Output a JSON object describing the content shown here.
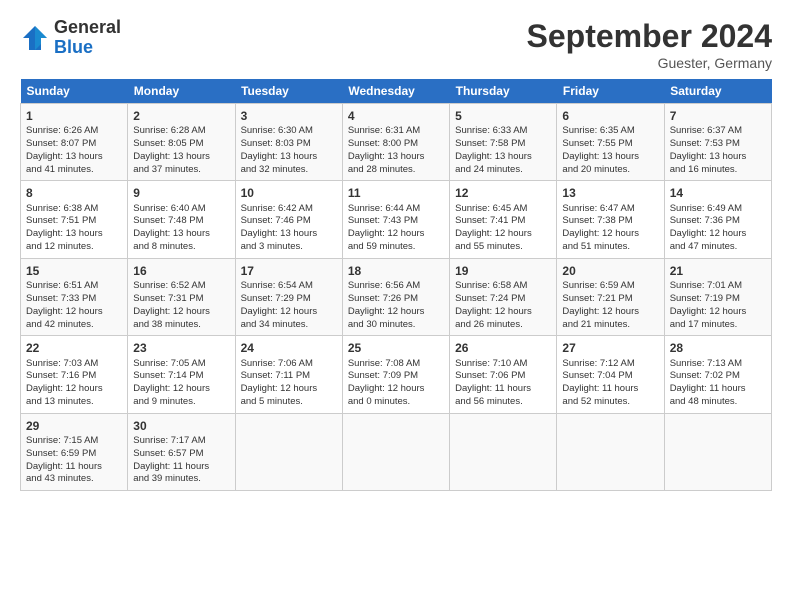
{
  "header": {
    "logo_line1": "General",
    "logo_line2": "Blue",
    "month": "September 2024",
    "location": "Guester, Germany"
  },
  "weekdays": [
    "Sunday",
    "Monday",
    "Tuesday",
    "Wednesday",
    "Thursday",
    "Friday",
    "Saturday"
  ],
  "weeks": [
    [
      {
        "day": "1",
        "lines": [
          "Sunrise: 6:26 AM",
          "Sunset: 8:07 PM",
          "Daylight: 13 hours",
          "and 41 minutes."
        ]
      },
      {
        "day": "2",
        "lines": [
          "Sunrise: 6:28 AM",
          "Sunset: 8:05 PM",
          "Daylight: 13 hours",
          "and 37 minutes."
        ]
      },
      {
        "day": "3",
        "lines": [
          "Sunrise: 6:30 AM",
          "Sunset: 8:03 PM",
          "Daylight: 13 hours",
          "and 32 minutes."
        ]
      },
      {
        "day": "4",
        "lines": [
          "Sunrise: 6:31 AM",
          "Sunset: 8:00 PM",
          "Daylight: 13 hours",
          "and 28 minutes."
        ]
      },
      {
        "day": "5",
        "lines": [
          "Sunrise: 6:33 AM",
          "Sunset: 7:58 PM",
          "Daylight: 13 hours",
          "and 24 minutes."
        ]
      },
      {
        "day": "6",
        "lines": [
          "Sunrise: 6:35 AM",
          "Sunset: 7:55 PM",
          "Daylight: 13 hours",
          "and 20 minutes."
        ]
      },
      {
        "day": "7",
        "lines": [
          "Sunrise: 6:37 AM",
          "Sunset: 7:53 PM",
          "Daylight: 13 hours",
          "and 16 minutes."
        ]
      }
    ],
    [
      {
        "day": "8",
        "lines": [
          "Sunrise: 6:38 AM",
          "Sunset: 7:51 PM",
          "Daylight: 13 hours",
          "and 12 minutes."
        ]
      },
      {
        "day": "9",
        "lines": [
          "Sunrise: 6:40 AM",
          "Sunset: 7:48 PM",
          "Daylight: 13 hours",
          "and 8 minutes."
        ]
      },
      {
        "day": "10",
        "lines": [
          "Sunrise: 6:42 AM",
          "Sunset: 7:46 PM",
          "Daylight: 13 hours",
          "and 3 minutes."
        ]
      },
      {
        "day": "11",
        "lines": [
          "Sunrise: 6:44 AM",
          "Sunset: 7:43 PM",
          "Daylight: 12 hours",
          "and 59 minutes."
        ]
      },
      {
        "day": "12",
        "lines": [
          "Sunrise: 6:45 AM",
          "Sunset: 7:41 PM",
          "Daylight: 12 hours",
          "and 55 minutes."
        ]
      },
      {
        "day": "13",
        "lines": [
          "Sunrise: 6:47 AM",
          "Sunset: 7:38 PM",
          "Daylight: 12 hours",
          "and 51 minutes."
        ]
      },
      {
        "day": "14",
        "lines": [
          "Sunrise: 6:49 AM",
          "Sunset: 7:36 PM",
          "Daylight: 12 hours",
          "and 47 minutes."
        ]
      }
    ],
    [
      {
        "day": "15",
        "lines": [
          "Sunrise: 6:51 AM",
          "Sunset: 7:33 PM",
          "Daylight: 12 hours",
          "and 42 minutes."
        ]
      },
      {
        "day": "16",
        "lines": [
          "Sunrise: 6:52 AM",
          "Sunset: 7:31 PM",
          "Daylight: 12 hours",
          "and 38 minutes."
        ]
      },
      {
        "day": "17",
        "lines": [
          "Sunrise: 6:54 AM",
          "Sunset: 7:29 PM",
          "Daylight: 12 hours",
          "and 34 minutes."
        ]
      },
      {
        "day": "18",
        "lines": [
          "Sunrise: 6:56 AM",
          "Sunset: 7:26 PM",
          "Daylight: 12 hours",
          "and 30 minutes."
        ]
      },
      {
        "day": "19",
        "lines": [
          "Sunrise: 6:58 AM",
          "Sunset: 7:24 PM",
          "Daylight: 12 hours",
          "and 26 minutes."
        ]
      },
      {
        "day": "20",
        "lines": [
          "Sunrise: 6:59 AM",
          "Sunset: 7:21 PM",
          "Daylight: 12 hours",
          "and 21 minutes."
        ]
      },
      {
        "day": "21",
        "lines": [
          "Sunrise: 7:01 AM",
          "Sunset: 7:19 PM",
          "Daylight: 12 hours",
          "and 17 minutes."
        ]
      }
    ],
    [
      {
        "day": "22",
        "lines": [
          "Sunrise: 7:03 AM",
          "Sunset: 7:16 PM",
          "Daylight: 12 hours",
          "and 13 minutes."
        ]
      },
      {
        "day": "23",
        "lines": [
          "Sunrise: 7:05 AM",
          "Sunset: 7:14 PM",
          "Daylight: 12 hours",
          "and 9 minutes."
        ]
      },
      {
        "day": "24",
        "lines": [
          "Sunrise: 7:06 AM",
          "Sunset: 7:11 PM",
          "Daylight: 12 hours",
          "and 5 minutes."
        ]
      },
      {
        "day": "25",
        "lines": [
          "Sunrise: 7:08 AM",
          "Sunset: 7:09 PM",
          "Daylight: 12 hours",
          "and 0 minutes."
        ]
      },
      {
        "day": "26",
        "lines": [
          "Sunrise: 7:10 AM",
          "Sunset: 7:06 PM",
          "Daylight: 11 hours",
          "and 56 minutes."
        ]
      },
      {
        "day": "27",
        "lines": [
          "Sunrise: 7:12 AM",
          "Sunset: 7:04 PM",
          "Daylight: 11 hours",
          "and 52 minutes."
        ]
      },
      {
        "day": "28",
        "lines": [
          "Sunrise: 7:13 AM",
          "Sunset: 7:02 PM",
          "Daylight: 11 hours",
          "and 48 minutes."
        ]
      }
    ],
    [
      {
        "day": "29",
        "lines": [
          "Sunrise: 7:15 AM",
          "Sunset: 6:59 PM",
          "Daylight: 11 hours",
          "and 43 minutes."
        ]
      },
      {
        "day": "30",
        "lines": [
          "Sunrise: 7:17 AM",
          "Sunset: 6:57 PM",
          "Daylight: 11 hours",
          "and 39 minutes."
        ]
      },
      null,
      null,
      null,
      null,
      null
    ]
  ]
}
